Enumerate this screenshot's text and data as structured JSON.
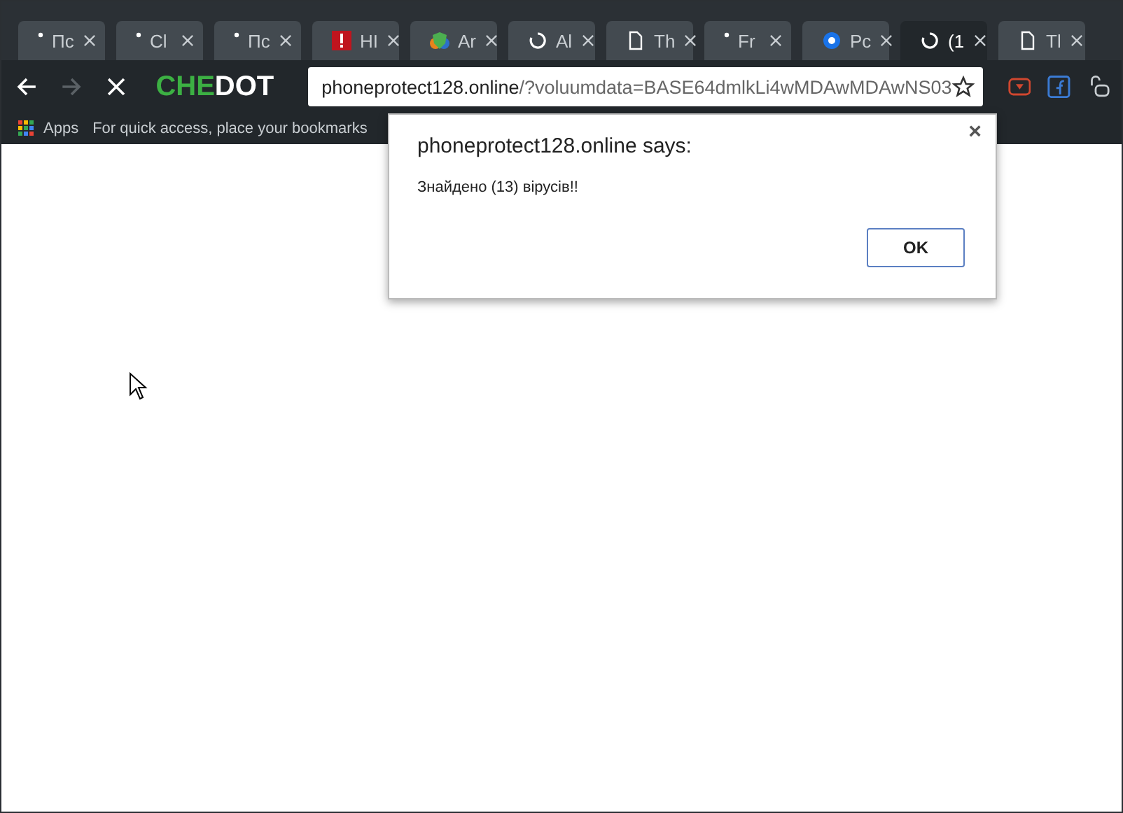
{
  "tabs": [
    {
      "label": "Пс",
      "kind": "dot",
      "selected": false
    },
    {
      "label": "Cl",
      "kind": "dot",
      "selected": false
    },
    {
      "label": "Пс",
      "kind": "dot",
      "selected": false
    },
    {
      "label": "HI",
      "kind": "alert",
      "selected": false
    },
    {
      "label": "Ar",
      "kind": "shield",
      "selected": false
    },
    {
      "label": "Al",
      "kind": "spinner",
      "selected": false
    },
    {
      "label": "Th",
      "kind": "page",
      "selected": false
    },
    {
      "label": "Fr",
      "kind": "dot",
      "selected": false
    },
    {
      "label": "Pc",
      "kind": "circle",
      "selected": false
    },
    {
      "label": "(1",
      "kind": "spinner",
      "selected": true
    },
    {
      "label": "Tl",
      "kind": "page",
      "selected": false
    }
  ],
  "toolbar": {
    "logo_primary": "CHE",
    "logo_secondary": "DOT",
    "forward_disabled": true,
    "url_host": "phoneprotect128.online",
    "url_path": "/?voluumdata=BASE64dmlkLi4wMDAwMDAwNS03"
  },
  "bookmarks_bar": {
    "apps": "Apps",
    "hint": "For quick access, place your bookmarks"
  },
  "dialog": {
    "title": "phoneprotect128.online says:",
    "message": "Знайдено (13) вірусів!!",
    "close": "×",
    "button": "OK"
  }
}
